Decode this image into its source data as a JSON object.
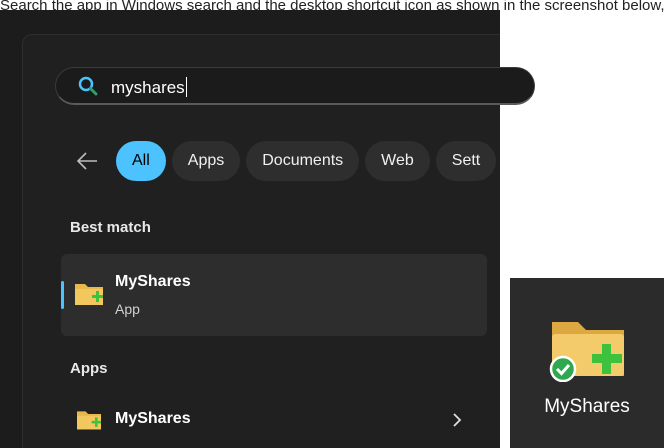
{
  "caption": "Search the app in Windows search and the desktop shortcut icon as shown in the screenshot below, and you have the application ready to use.",
  "search": {
    "query": "myshares"
  },
  "filters": [
    "All",
    "Apps",
    "Documents",
    "Web",
    "Sett"
  ],
  "best_match": {
    "heading": "Best match",
    "title": "MyShares",
    "subtitle": "App"
  },
  "apps": {
    "heading": "Apps",
    "items": [
      {
        "title": "MyShares"
      }
    ]
  },
  "desktop_shortcut": {
    "label": "MyShares"
  },
  "colors": {
    "accent": "#4cc2ff",
    "panel": "#202020",
    "chip": "#2e2e2e",
    "green_plus": "#3ec23e"
  },
  "icons": [
    "search-icon",
    "back-arrow-icon",
    "folder-share-icon",
    "chevron-right-icon",
    "check-badge-icon"
  ]
}
